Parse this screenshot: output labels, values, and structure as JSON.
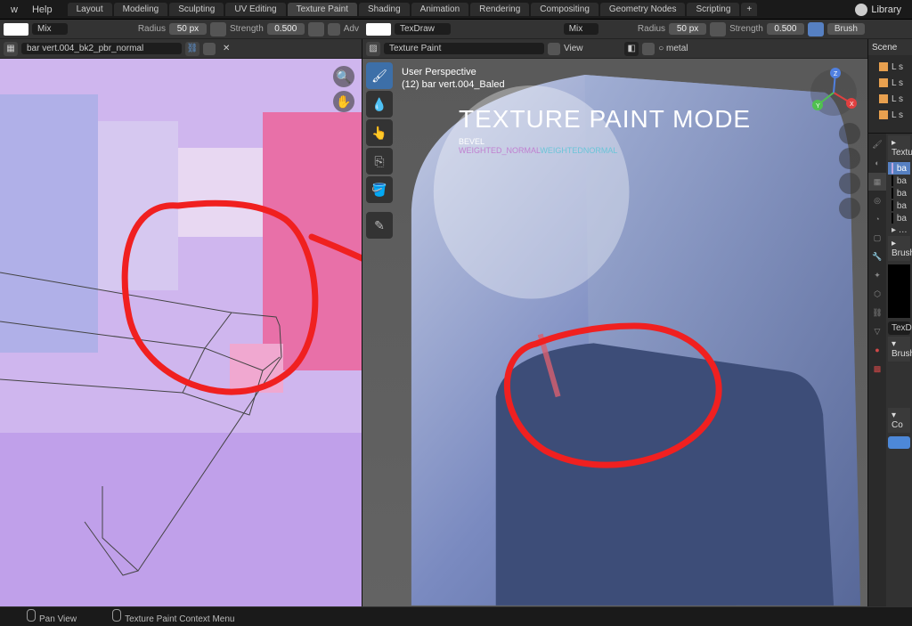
{
  "menubar": {
    "menu1": "w",
    "menu2": "Help",
    "tabs": [
      "Layout",
      "Modeling",
      "Sculpting",
      "UV Editing",
      "Texture Paint",
      "Shading",
      "Animation",
      "Rendering",
      "Compositing",
      "Geometry Nodes",
      "Scripting"
    ],
    "library": "Library"
  },
  "toolbar_left": {
    "mix": "Mix",
    "radius_label": "Radius",
    "radius_val": "50 px",
    "strength_label": "Strength",
    "strength_val": "0.500",
    "adv": "Adv"
  },
  "hdr_uv": {
    "img_name": "bar vert.004_bk2_pbr_normal"
  },
  "toolbar_right": {
    "texdraw": "TexDraw",
    "mix": "Mix",
    "radius_label": "Radius",
    "radius_val": "50 px",
    "strength_label": "Strength",
    "strength_val": "0.500",
    "brush": "Brush"
  },
  "hdr_vp": {
    "mode": "Texture Paint",
    "view": "View",
    "metal": "metal"
  },
  "viewport": {
    "persp": "User Perspective",
    "obj": "(12) bar vert.004_Baled",
    "title": "TEXTURE PAINT MODE",
    "sub1": "BEVEL",
    "sub2": "WEIGHTED_NORMAL",
    "sub3": "WEIGHTEDNORMAL"
  },
  "outliner": {
    "scene": "Scene",
    "items": [
      "L s",
      "L s",
      "L s",
      "L s"
    ]
  },
  "props": {
    "sect1": "Textu",
    "images": [
      "ba",
      "ba",
      "ba",
      "ba",
      "ba"
    ],
    "sect2": "Brush",
    "texdraw": "TexDra",
    "sect3": "Brush",
    "sect4": "Co"
  },
  "statusbar": {
    "s1": "Pan View",
    "s2": "Texture Paint Context Menu"
  }
}
